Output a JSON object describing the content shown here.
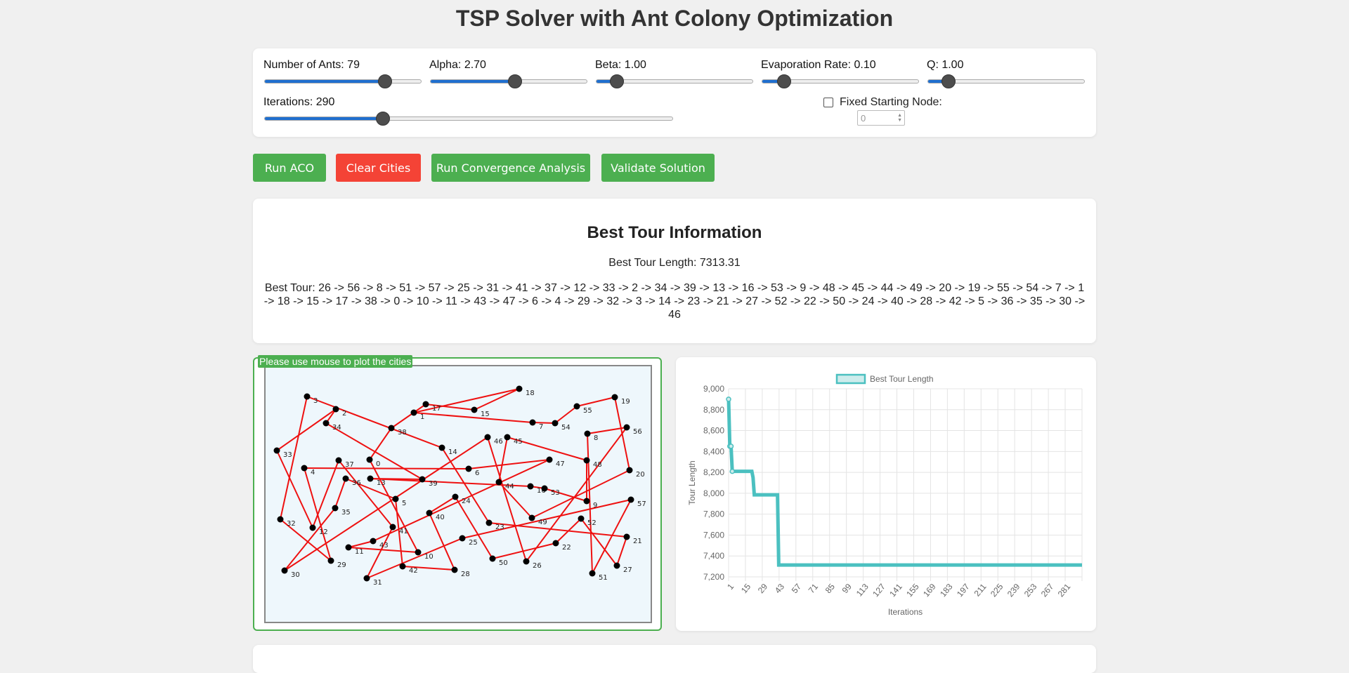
{
  "page": {
    "title": "TSP Solver with Ant Colony Optimization"
  },
  "controls": {
    "ants": {
      "label": "Number of Ants: 79",
      "value": 79,
      "fraction": 0.77
    },
    "alpha": {
      "label": "Alpha: 2.70",
      "value": 2.7,
      "fraction": 0.54
    },
    "beta": {
      "label": "Beta: 1.00",
      "value": 1.0,
      "fraction": 0.13
    },
    "evaporation": {
      "label": "Evaporation Rate: 0.10",
      "value": 0.1,
      "fraction": 0.14
    },
    "q": {
      "label": "Q: 1.00",
      "value": 1.0,
      "fraction": 0.13
    },
    "iterations": {
      "label": "Iterations: 290",
      "value": 290,
      "fraction": 0.29
    },
    "fixed_start": {
      "label": "Fixed Starting Node:",
      "checked": false,
      "value": "0"
    }
  },
  "buttons": {
    "run": "Run ACO",
    "clear": "Clear Cities",
    "convergence": "Run Convergence Analysis",
    "validate": "Validate Solution"
  },
  "colors": {
    "green": "#4caf50",
    "red": "#f44336",
    "edge": "#ee1111",
    "series": "#4bc0c0"
  },
  "tour_info": {
    "heading": "Best Tour Information",
    "length_text": "Best Tour Length: 7313.31",
    "tour_text": "Best Tour: 26 -> 56 -> 8 -> 51 -> 57 -> 25 -> 31 -> 41 -> 37 -> 12 -> 33 -> 2 -> 34 -> 39 -> 13 -> 16 -> 53 -> 9 -> 48 -> 45 -> 44 -> 49 -> 20 -> 19 -> 55 -> 54 -> 7 -> 1 -> 18 -> 15 -> 17 -> 38 -> 0 -> 10 -> 11 -> 43 -> 47 -> 6 -> 4 -> 29 -> 32 -> 3 -> 14 -> 23 -> 21 -> 27 -> 52 -> 22 -> 50 -> 24 -> 40 -> 28 -> 42 -> 5 -> 36 -> 35 -> 30 -> 46",
    "tour_order": [
      26,
      56,
      8,
      51,
      57,
      25,
      31,
      41,
      37,
      12,
      33,
      2,
      34,
      39,
      13,
      16,
      53,
      9,
      48,
      45,
      44,
      49,
      20,
      19,
      55,
      54,
      7,
      1,
      18,
      15,
      17,
      38,
      0,
      10,
      11,
      43,
      47,
      6,
      4,
      29,
      32,
      3,
      14,
      23,
      21,
      27,
      52,
      22,
      50,
      24,
      40,
      28,
      42,
      5,
      36,
      35,
      30,
      46
    ]
  },
  "canvas": {
    "hint": "Please use mouse to plot the cities",
    "city_labels": [
      "0",
      "1",
      "2",
      "3",
      "4",
      "5",
      "6",
      "7",
      "8",
      "9",
      "10",
      "11",
      "12",
      "13",
      "14",
      "15",
      "16",
      "17",
      "18",
      "19",
      "20",
      "21",
      "22",
      "23",
      "24",
      "25",
      "26",
      "27",
      "28",
      "29",
      "30",
      "31",
      "32",
      "33",
      "34",
      "35",
      "36",
      "37",
      "38",
      "39",
      "40",
      "41",
      "42",
      "43",
      "44",
      "45",
      "46",
      "47",
      "48",
      "49",
      "50",
      "51",
      "52",
      "53",
      "54",
      "55",
      "56",
      "57"
    ]
  },
  "chart_data": {
    "type": "line",
    "legend": "Best Tour Length",
    "legend_position": "top",
    "xlabel": "Iterations",
    "ylabel": "Tour Length",
    "x_tick_labels": [
      "1",
      "15",
      "29",
      "43",
      "57",
      "71",
      "85",
      "99",
      "113",
      "127",
      "141",
      "155",
      "169",
      "183",
      "197",
      "211",
      "225",
      "239",
      "253",
      "267",
      "281"
    ],
    "y_tick_labels": [
      "7,200",
      "7,400",
      "7,600",
      "7,800",
      "8,000",
      "8,200",
      "8,400",
      "8,600",
      "8,800",
      "9,000"
    ],
    "ylim": [
      7200,
      9000
    ],
    "xlim": [
      1,
      290
    ],
    "grid": true,
    "series": [
      {
        "name": "Best Tour Length",
        "points": [
          [
            1,
            8900
          ],
          [
            2,
            8450
          ],
          [
            3,
            8450
          ],
          [
            4,
            8210
          ],
          [
            20,
            8210
          ],
          [
            21,
            8150
          ],
          [
            22,
            7985
          ],
          [
            41,
            7985
          ],
          [
            42,
            7313
          ],
          [
            290,
            7313
          ]
        ]
      }
    ]
  }
}
